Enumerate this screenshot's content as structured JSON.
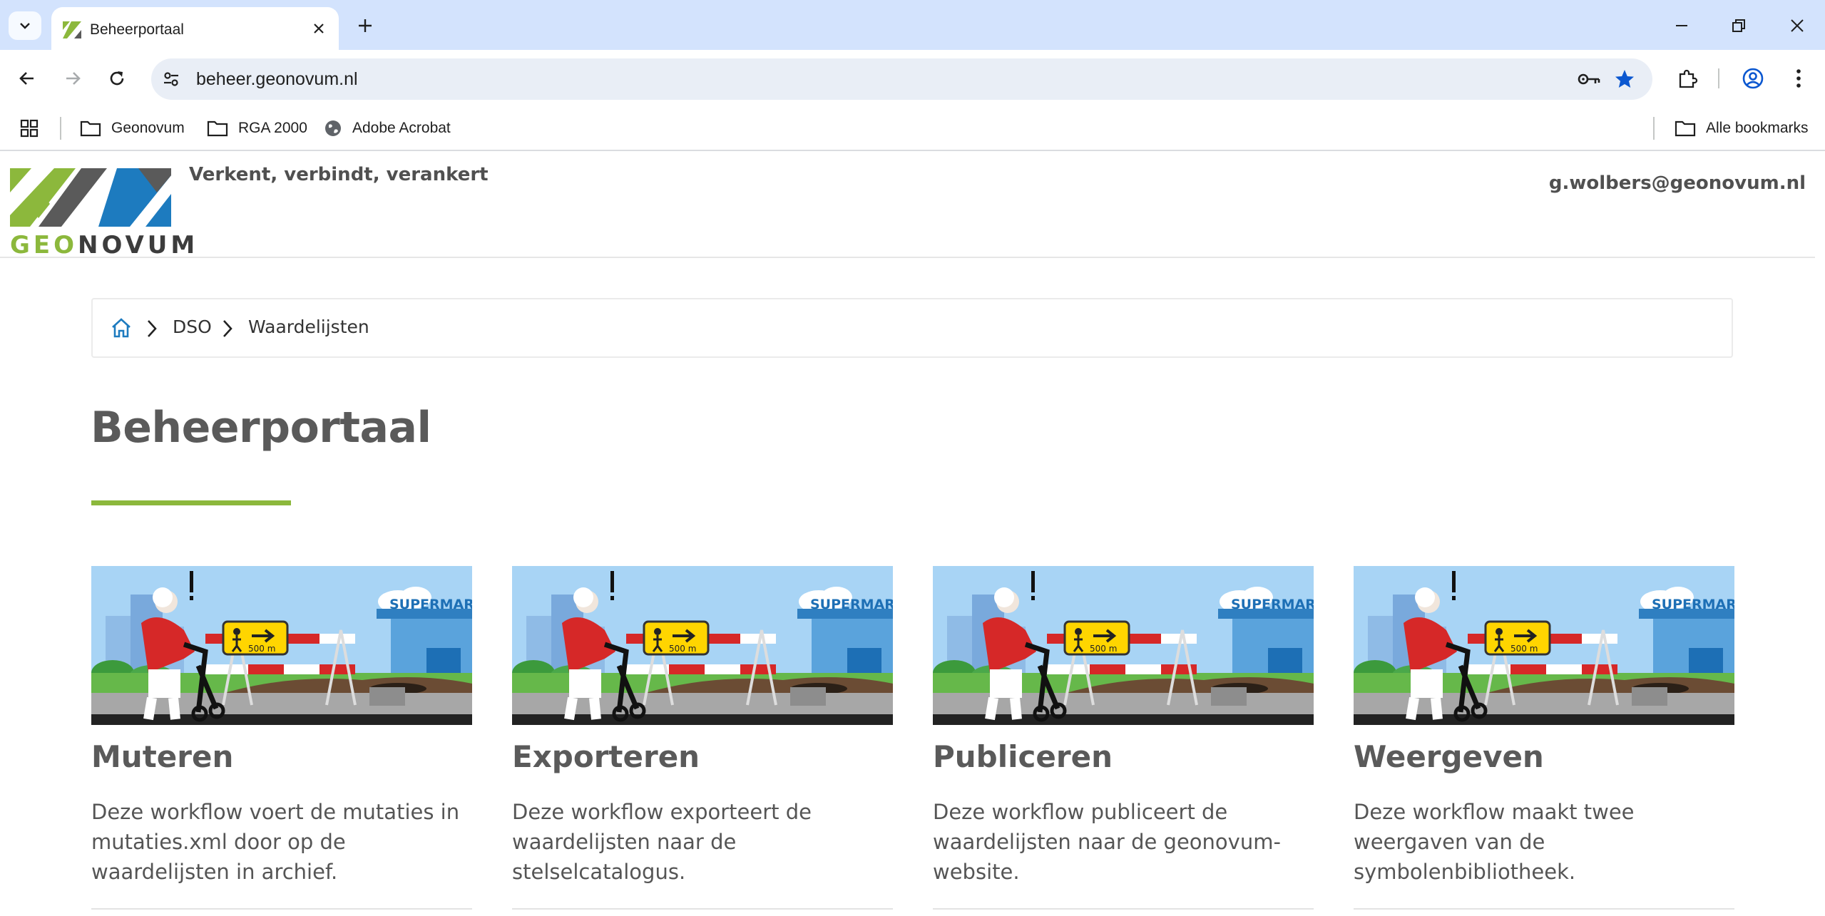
{
  "browser": {
    "tab_title": "Beheerportaal",
    "url": "beheer.geonovum.nl",
    "bookmarks": [
      {
        "label": "Geonovum",
        "icon": "folder-icon"
      },
      {
        "label": "RGA 2000",
        "icon": "folder-icon"
      },
      {
        "label": "Adobe Acrobat",
        "icon": "globe-icon"
      }
    ],
    "all_bookmarks": "Alle bookmarks"
  },
  "header": {
    "logo_geo": "GEO",
    "logo_novum": "NOVUM",
    "tagline": "Verkent, verbindt, verankert",
    "user_email": "g.wolbers@geonovum.nl"
  },
  "breadcrumb": [
    "DSO",
    "Waardelijsten"
  ],
  "page_title": "Beheerportaal",
  "illustration": {
    "sign_text": "500 m",
    "shop_text": "SUPERMARK"
  },
  "cards": [
    {
      "title": "Muteren",
      "text": "Deze workflow voert de mutaties in mutaties.xml door op de waardelijsten in archief."
    },
    {
      "title": "Exporteren",
      "text": "Deze workflow exporteert de waardelijsten naar de stelselcatalogus."
    },
    {
      "title": "Publiceren",
      "text": "Deze workflow publiceert de waardelijsten naar de geonovum-website."
    },
    {
      "title": "Weergeven",
      "text": "Deze workflow maakt twee weergaven van de symbolenbibliotheek."
    }
  ],
  "colors": {
    "tabstrip": "#d3e3fd",
    "brand_green": "#8cb83c",
    "brand_blue": "#1d7bbf",
    "brand_grey": "#505050",
    "bookmark_star": "#0b57d0"
  }
}
